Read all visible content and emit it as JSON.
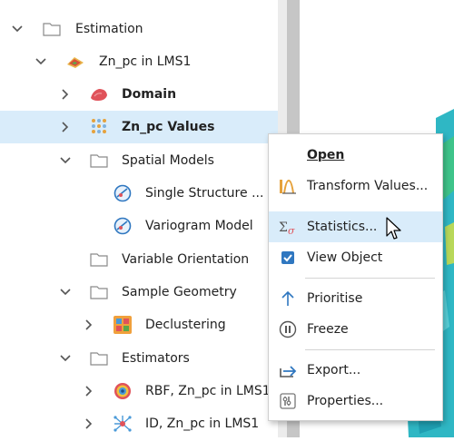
{
  "tree": {
    "items": [
      {
        "label": "Estimation",
        "icon": "folder-icon"
      },
      {
        "label": "Zn_pc in LMS1",
        "icon": "domained-estimator-icon"
      },
      {
        "label": "Domain",
        "icon": "domain-icon"
      },
      {
        "label": "Zn_pc Values",
        "icon": "point-values-icon"
      },
      {
        "label": "Spatial Models",
        "icon": "folder-icon"
      },
      {
        "label": "Single Structure ...",
        "icon": "variogram-icon"
      },
      {
        "label": "Variogram Model",
        "icon": "variogram-icon"
      },
      {
        "label": "Variable Orientation",
        "icon": "folder-icon"
      },
      {
        "label": "Sample Geometry",
        "icon": "folder-icon"
      },
      {
        "label": "Declustering",
        "icon": "declustering-icon"
      },
      {
        "label": "Estimators",
        "icon": "folder-icon"
      },
      {
        "label": "RBF, Zn_pc in LMS1",
        "icon": "rbf-icon"
      },
      {
        "label": "ID, Zn_pc in LMS1",
        "icon": "id-estimator-icon"
      }
    ]
  },
  "context_menu": {
    "items": [
      {
        "label": "Open",
        "icon": ""
      },
      {
        "label": "Transform Values...",
        "icon": "transform-values-icon"
      },
      {
        "label": "Statistics...",
        "icon": "statistics-icon"
      },
      {
        "label": "View Object",
        "icon": "checkbox-checked-icon"
      },
      {
        "label": "Prioritise",
        "icon": "arrow-up-icon"
      },
      {
        "label": "Freeze",
        "icon": "pause-icon"
      },
      {
        "label": "Export...",
        "icon": "export-icon"
      },
      {
        "label": "Properties...",
        "icon": "properties-icon"
      }
    ]
  },
  "colors": {
    "selection": "#d9ecfa",
    "accent": "#2f77c0",
    "viewport_surface": "#2fb7c4"
  }
}
